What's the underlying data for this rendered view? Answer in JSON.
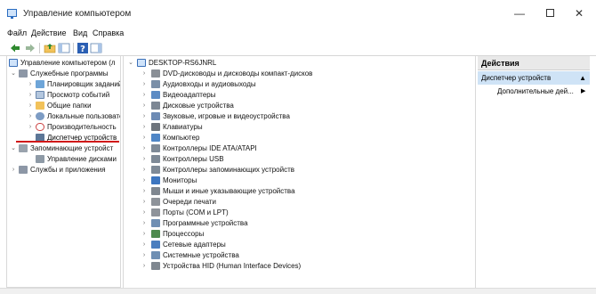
{
  "window": {
    "title": "Управление компьютером",
    "controls": {
      "minimize": "—",
      "close": "✕"
    }
  },
  "menu": [
    "Файл",
    "Действие",
    "Вид",
    "Справка"
  ],
  "toolbar_icons": [
    "back-arrow-icon",
    "forward-arrow-icon",
    "up-folder-icon",
    "show-hide-tree-icon",
    "help-icon",
    "view-icon"
  ],
  "left_tree": {
    "root": "Управление компьютером (л",
    "items": [
      {
        "label": "Служебные программы",
        "expanded": true
      },
      {
        "label": "Планировщик заданий"
      },
      {
        "label": "Просмотр событий"
      },
      {
        "label": "Общие папки"
      },
      {
        "label": "Локальные пользовате"
      },
      {
        "label": "Производительность"
      },
      {
        "label": "Диспетчер устройств",
        "selected": true
      },
      {
        "label": "Запоминающие устройст",
        "expanded": true
      },
      {
        "label": "Управление дисками"
      },
      {
        "label": "Службы и приложения"
      }
    ]
  },
  "device_tree": {
    "root": "DESKTOP-RS6JNRL",
    "categories": [
      "DVD-дисководы и дисководы компакт-дисков",
      "Аудиовходы и аудиовыходы",
      "Видеоадаптеры",
      "Дисковые устройства",
      "Звуковые, игровые и видеоустройства",
      "Клавиатуры",
      "Компьютер",
      "Контроллеры IDE ATA/ATAPI",
      "Контроллеры USB",
      "Контроллеры запоминающих устройств",
      "Мониторы",
      "Мыши и иные указывающие устройства",
      "Очереди печати",
      "Порты (COM и LPT)",
      "Программные устройства",
      "Процессоры",
      "Сетевые адаптеры",
      "Системные устройства",
      "Устройства HID (Human Interface Devices)"
    ]
  },
  "actions": {
    "header": "Действия",
    "group": "Диспетчер устройств",
    "item": "Дополнительные дей..."
  },
  "colors": {
    "accent_red_underline": "#d01818",
    "selection_blue": "#cfe3f6"
  }
}
